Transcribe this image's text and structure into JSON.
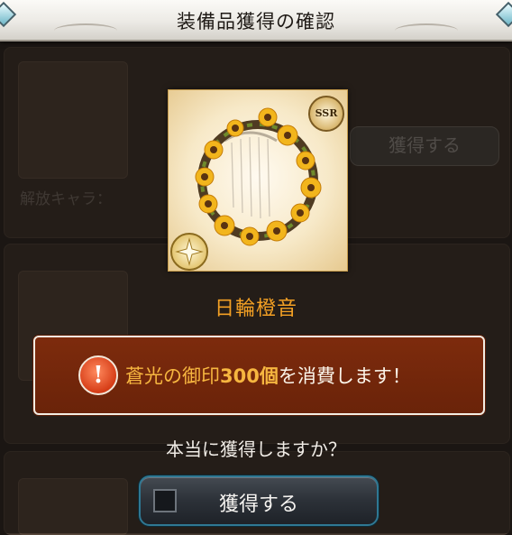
{
  "dialog": {
    "title": "装備品獲得の確認",
    "item_name": "日輪橙音",
    "item_rarity": "SSR",
    "notice": {
      "icon": "!",
      "highlight": "蒼光の御印",
      "quantity": "300個",
      "rest": "を消費します！"
    },
    "question": "本当に獲得しますか？",
    "confirm_label": "獲得する"
  },
  "background": {
    "button_labels": [
      "獲得する"
    ],
    "release_label": "解放キャラ：",
    "colors": {
      "accent_orange": "#f3a024",
      "notice_red": "#7d2b0d",
      "button_border": "#2f7893"
    }
  },
  "icons": {
    "warning": "exclamation-circle-icon",
    "element": "light-element-icon",
    "checkbox": "checkbox-icon"
  }
}
